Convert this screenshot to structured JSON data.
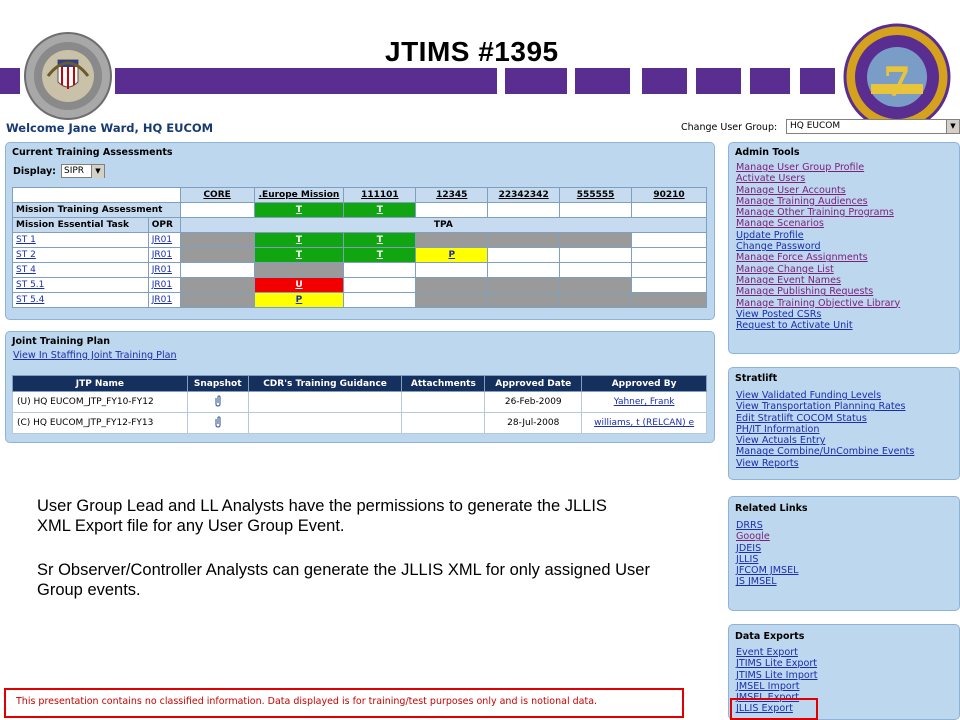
{
  "slide_title": "JTIMS #1395",
  "welcome": "Welcome Jane Ward, HQ EUCOM",
  "change_group_label": "Change User Group:",
  "change_group_value": "HQ EUCOM",
  "assessments": {
    "title": "Current Training Assessments",
    "display_label": "Display:",
    "display_value": "SIPR",
    "columns": [
      "CORE",
      ".Europe Mission",
      "111101",
      "12345",
      "22342342",
      "555555",
      "90210"
    ],
    "mission_training_label": "Mission Training Assessment",
    "mission_essential_label": "Mission Essential Task",
    "opr_label": "OPR",
    "tpa_label": "TPA",
    "rows": [
      {
        "task": "ST 1",
        "opr": "JR01"
      },
      {
        "task": "ST 2",
        "opr": "JR01"
      },
      {
        "task": "ST 4",
        "opr": "JR01"
      },
      {
        "task": "ST 5.1",
        "opr": "JR01"
      },
      {
        "task": "ST 5.4",
        "opr": "JR01"
      }
    ],
    "marks": {
      "t": "T",
      "p": "P",
      "u": "U"
    }
  },
  "jtp": {
    "title": "Joint Training Plan",
    "link": "View In Staffing Joint Training Plan",
    "headers": [
      "JTP Name",
      "Snapshot",
      "CDR's Training Guidance",
      "Attachments",
      "Approved Date",
      "Approved By"
    ],
    "rows": [
      {
        "name": "(U) HQ EUCOM_JTP_FY10-FY12",
        "date": "26-Feb-2009",
        "by": "Yahner, Frank"
      },
      {
        "name": "(C) HQ EUCOM_JTP_FY12-FY13",
        "date": "28-Jul-2008",
        "by": "williams, t (RELCAN) e"
      }
    ]
  },
  "admin_tools": {
    "title": "Admin Tools",
    "links": [
      "Manage User Group Profile",
      "Activate Users",
      "Manage User Accounts",
      "Manage Training Audiences",
      "Manage Other Training Programs",
      "Manage Scenarios",
      "Update Profile",
      "Change Password",
      "Manage Force Assignments",
      "Manage Change List",
      "Manage Event Names",
      "Manage Publishing Requests",
      "Manage Training Objective Library",
      "View Posted CSRs",
      "Request to Activate Unit"
    ]
  },
  "stratlift": {
    "title": "Stratlift",
    "links": [
      "View Validated Funding Levels",
      "View Transportation Planning Rates",
      "Edit Stratlift COCOM Status",
      "PH/IT Information",
      "View Actuals Entry",
      "Manage Combine/UnCombine Events",
      "View Reports"
    ]
  },
  "related_links": {
    "title": "Related Links",
    "links": [
      "DRRS",
      "Google",
      "JDEIS",
      "JLLIS",
      "JFCOM JMSEL",
      "JS JMSEL"
    ]
  },
  "data_exports": {
    "title": "Data Exports",
    "links": [
      "Event Export",
      "JTIMS Lite Export",
      "JTIMS Lite Import",
      "JMSEL Import",
      "JMSEL Export",
      "JLLIS Export"
    ]
  },
  "body_text": {
    "p1": "User Group Lead and LL Analysts have the permissions to generate the JLLIS XML Export file for any User Group Event.",
    "p2": "Sr Observer/Controller Analysts can generate the JLLIS XML for only assigned User Group events."
  },
  "disclaimer": "This presentation contains no classified information.  Data displayed is for training/test purposes only and is notional data.",
  "colors": {
    "accent_purple": "#5a2d91",
    "panel_blue": "#bdd7ee",
    "header_navy": "#16305e"
  }
}
